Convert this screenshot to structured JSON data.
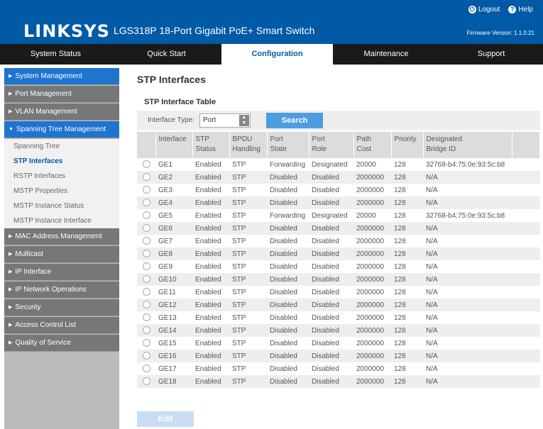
{
  "header": {
    "brand": "LINKSYS",
    "product": "LGS318P 18-Port Gigabit PoE+ Smart Switch",
    "logout_label": "Logout",
    "help_label": "Help",
    "firmware": "Firmware Version: 1.1.0.21"
  },
  "mainnav": {
    "tabs": [
      {
        "label": "System Status"
      },
      {
        "label": "Quick Start"
      },
      {
        "label": "Configuration"
      },
      {
        "label": "Maintenance"
      },
      {
        "label": "Support"
      }
    ]
  },
  "sidebar": {
    "items": [
      {
        "label": "System Management"
      },
      {
        "label": "Port Management"
      },
      {
        "label": "VLAN Management"
      },
      {
        "label": "Spanning Tree Management"
      },
      {
        "label": "MAC Address Management"
      },
      {
        "label": "Multicast"
      },
      {
        "label": "IP Interface"
      },
      {
        "label": "IP Network Operations"
      },
      {
        "label": "Security"
      },
      {
        "label": "Access Control List"
      },
      {
        "label": "Quality of Service"
      }
    ],
    "subitems": [
      {
        "label": "Spanning Tree"
      },
      {
        "label": "STP Interfaces"
      },
      {
        "label": "RSTP Interfaces"
      },
      {
        "label": "MSTP Properties"
      },
      {
        "label": "MSTP Instance Status"
      },
      {
        "label": "MSTP Instance Interface"
      }
    ]
  },
  "main": {
    "title": "STP Interfaces",
    "table_title": "STP Interface Table",
    "filter_label": "Interface Type:",
    "filter_value": "Port",
    "search_label": "Search",
    "edit_label": "Edit",
    "columns": [
      {
        "l1": "Interface",
        "l2": ""
      },
      {
        "l1": "STP",
        "l2": "Status"
      },
      {
        "l1": "BPDU",
        "l2": "Handling"
      },
      {
        "l1": "Port",
        "l2": "State"
      },
      {
        "l1": "Port",
        "l2": "Role"
      },
      {
        "l1": "Path",
        "l2": "Cost"
      },
      {
        "l1": "Priority",
        "l2": ""
      },
      {
        "l1": "Designated",
        "l2": "Bridge ID"
      }
    ],
    "rows": [
      [
        "GE1",
        "Enabled",
        "STP",
        "Forwarding",
        "Designated",
        "20000",
        "128",
        "32768-b4:75:0e:93:5c:b8"
      ],
      [
        "GE2",
        "Enabled",
        "STP",
        "Disabled",
        "Disabled",
        "2000000",
        "128",
        "N/A"
      ],
      [
        "GE3",
        "Enabled",
        "STP",
        "Disabled",
        "Disabled",
        "2000000",
        "128",
        "N/A"
      ],
      [
        "GE4",
        "Enabled",
        "STP",
        "Disabled",
        "Disabled",
        "2000000",
        "128",
        "N/A"
      ],
      [
        "GE5",
        "Enabled",
        "STP",
        "Forwarding",
        "Designated",
        "20000",
        "128",
        "32768-b4:75:0e:93:5c:b8"
      ],
      [
        "GE6",
        "Enabled",
        "STP",
        "Disabled",
        "Disabled",
        "2000000",
        "128",
        "N/A"
      ],
      [
        "GE7",
        "Enabled",
        "STP",
        "Disabled",
        "Disabled",
        "2000000",
        "128",
        "N/A"
      ],
      [
        "GE8",
        "Enabled",
        "STP",
        "Disabled",
        "Disabled",
        "2000000",
        "128",
        "N/A"
      ],
      [
        "GE9",
        "Enabled",
        "STP",
        "Disabled",
        "Disabled",
        "2000000",
        "128",
        "N/A"
      ],
      [
        "GE10",
        "Enabled",
        "STP",
        "Disabled",
        "Disabled",
        "2000000",
        "128",
        "N/A"
      ],
      [
        "GE11",
        "Enabled",
        "STP",
        "Disabled",
        "Disabled",
        "2000000",
        "128",
        "N/A"
      ],
      [
        "GE12",
        "Enabled",
        "STP",
        "Disabled",
        "Disabled",
        "2000000",
        "128",
        "N/A"
      ],
      [
        "GE13",
        "Enabled",
        "STP",
        "Disabled",
        "Disabled",
        "2000000",
        "128",
        "N/A"
      ],
      [
        "GE14",
        "Enabled",
        "STP",
        "Disabled",
        "Disabled",
        "2000000",
        "128",
        "N/A"
      ],
      [
        "GE15",
        "Enabled",
        "STP",
        "Disabled",
        "Disabled",
        "2000000",
        "128",
        "N/A"
      ],
      [
        "GE16",
        "Enabled",
        "STP",
        "Disabled",
        "Disabled",
        "2000000",
        "128",
        "N/A"
      ],
      [
        "GE17",
        "Enabled",
        "STP",
        "Disabled",
        "Disabled",
        "2000000",
        "128",
        "N/A"
      ],
      [
        "GE18",
        "Enabled",
        "STP",
        "Disabled",
        "Disabled",
        "2000000",
        "128",
        "N/A"
      ]
    ]
  },
  "colors": {
    "brand_blue": "#005aa6",
    "nav_black": "#1a1a1a",
    "sidebar_selected": "#1e74cf",
    "search_button": "#4d9de0"
  }
}
